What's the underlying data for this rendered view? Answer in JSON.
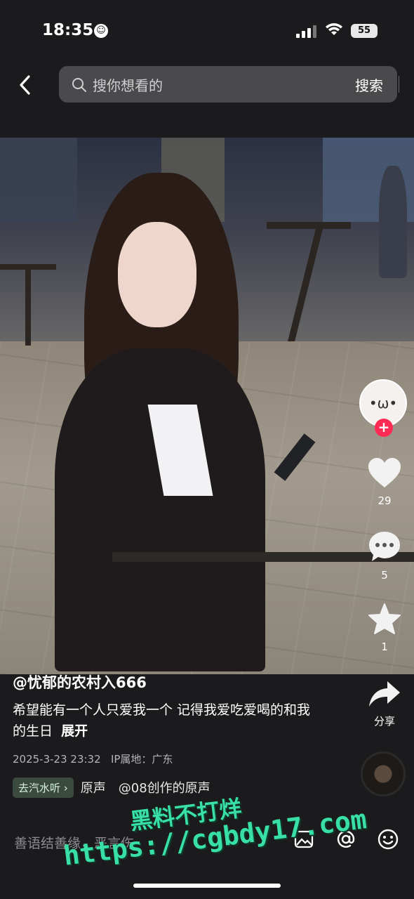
{
  "status_bar": {
    "time": "18:35",
    "battery": "55"
  },
  "search": {
    "placeholder": "搜你想看的",
    "button": "搜索"
  },
  "actions": {
    "likes": "29",
    "comments": "5",
    "favorites": "1",
    "share": "分享"
  },
  "caption": {
    "author": "@忧郁的农村入666",
    "text": "希望能有一个人只爱我一个 记得我爱吃爱喝的和我的生日",
    "expand": "展开",
    "date": "2025-3-23 23:32",
    "ip": "IP属地：广东"
  },
  "music": {
    "chip": "去汽水听 ›",
    "track": "原声　@08创作的原声"
  },
  "comment_bar": {
    "placeholder": "善语结善缘，恶言伤"
  },
  "watermark": {
    "line1": "黑料不打烊",
    "line2": "https://cgbdy17.com"
  },
  "colors": {
    "accent": "#fe2c55",
    "watermark": "#38e0a8"
  }
}
